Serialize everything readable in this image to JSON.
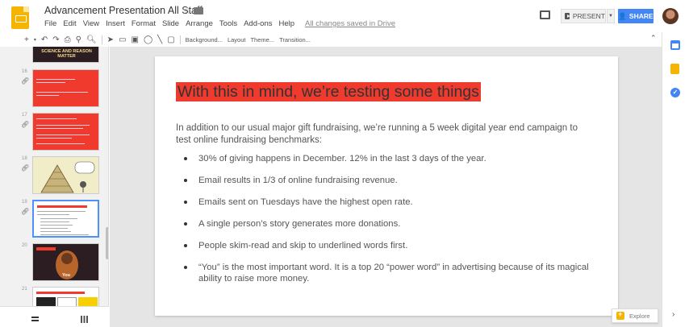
{
  "header": {
    "doc_title": "Advancement Presentation All Staff",
    "menu": [
      "File",
      "Edit",
      "View",
      "Insert",
      "Format",
      "Slide",
      "Arrange",
      "Tools",
      "Add-ons",
      "Help"
    ],
    "save_status": "All changes saved in Drive",
    "present_label": "PRESENT",
    "share_label": "SHARE",
    "icons": [
      "slides-logo-icon",
      "star-icon",
      "folder-icon",
      "comment-icon",
      "avatar"
    ]
  },
  "toolbar": {
    "background_label": "Background...",
    "layout_label": "Layout",
    "theme_label": "Theme...",
    "transition_label": "Transition..."
  },
  "filmstrip": {
    "slides": [
      {
        "number": "16"
      },
      {
        "number": "17"
      },
      {
        "number": "18"
      },
      {
        "number": "19",
        "selected": true
      },
      {
        "number": "20"
      },
      {
        "number": "21"
      }
    ],
    "thumb_15_title": "SCIENCE AND REASON MATTER",
    "thumb_20_caption": "You"
  },
  "slide": {
    "title": "With this in mind, we’re testing some things",
    "intro": "In addition to our usual major gift fundraising, we’re running a 5 week digital year end campaign to test online fundraising benchmarks:",
    "bullets": [
      "30% of giving happens in December. 12% in the last 3 days of the year.",
      "Email results in 1/3 of online fundraising revenue.",
      "Emails sent on Tuesdays have the highest open rate.",
      "A single person’s story generates more donations.",
      "People skim-read and skip to underlined words first.",
      "“You” is the most important word. It is a top 20 “power word” in advertising because of its magical ability to raise more money."
    ]
  },
  "explore_label": "Explore",
  "colors": {
    "accent_red": "#ef3a2d",
    "share_blue": "#4285f4",
    "logo_yellow": "#f4b400"
  }
}
